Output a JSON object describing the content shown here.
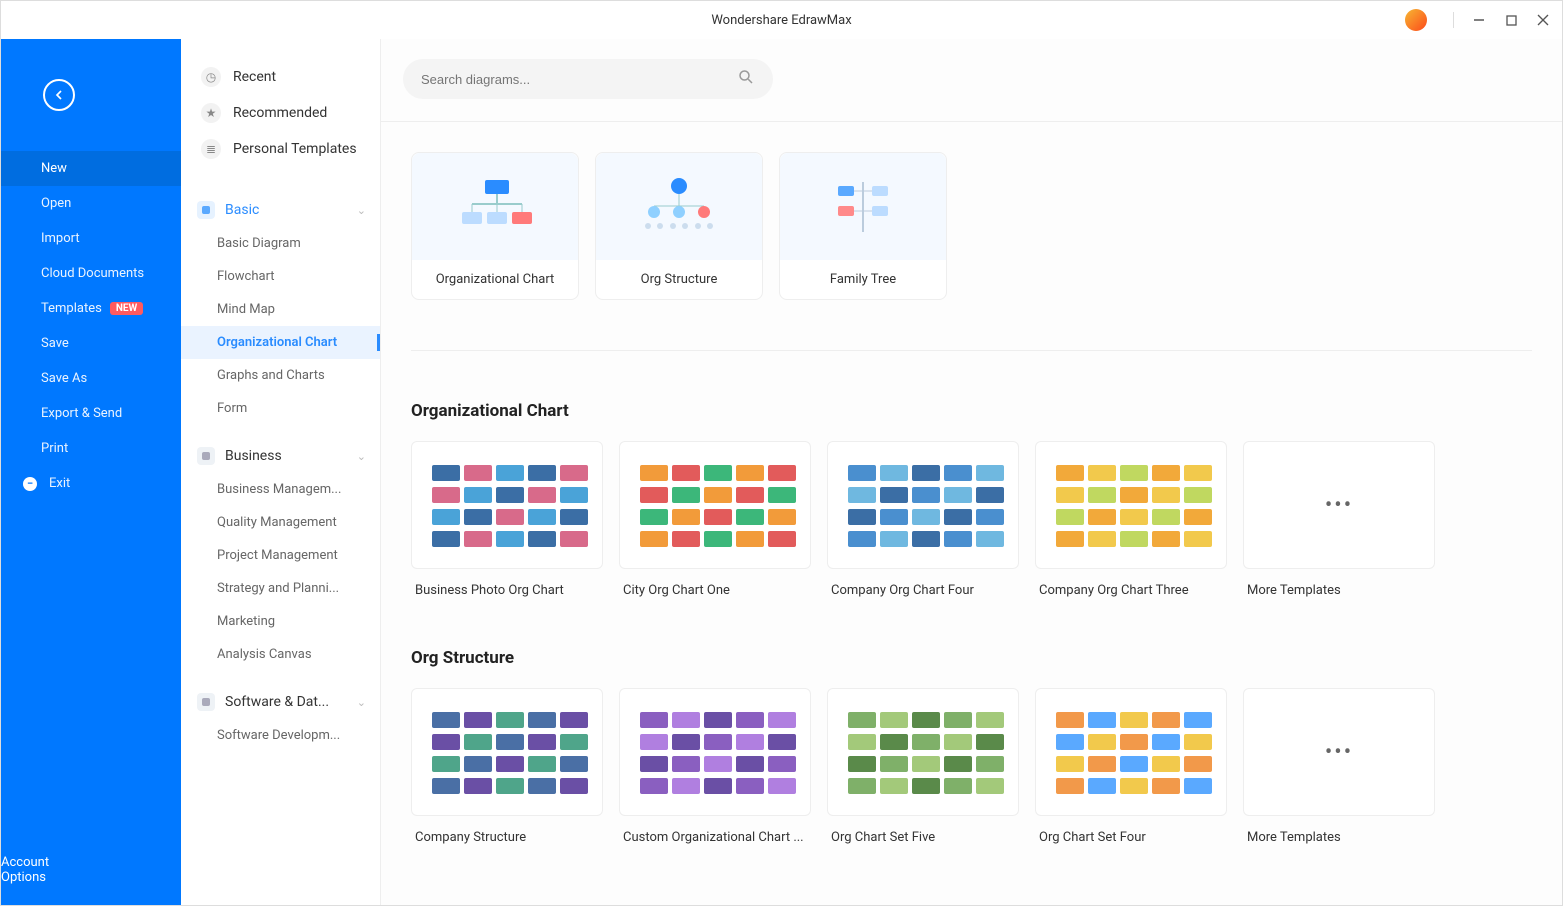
{
  "app_title": "Wondershare EdrawMax",
  "search": {
    "placeholder": "Search diagrams..."
  },
  "sidebar": {
    "items": [
      {
        "label": "New",
        "active": true
      },
      {
        "label": "Open"
      },
      {
        "label": "Import"
      },
      {
        "label": "Cloud Documents"
      },
      {
        "label": "Templates",
        "badge": "NEW"
      },
      {
        "label": "Save"
      },
      {
        "label": "Save As"
      },
      {
        "label": "Export & Send"
      },
      {
        "label": "Print"
      },
      {
        "label": "Exit",
        "exit": true
      }
    ],
    "bottom": [
      {
        "label": "Account"
      },
      {
        "label": "Options"
      }
    ]
  },
  "categories": {
    "top": [
      {
        "label": "Recent"
      },
      {
        "label": "Recommended"
      },
      {
        "label": "Personal Templates"
      }
    ],
    "groups": [
      {
        "label": "Basic",
        "active": true,
        "children": [
          {
            "label": "Basic Diagram"
          },
          {
            "label": "Flowchart"
          },
          {
            "label": "Mind Map"
          },
          {
            "label": "Organizational Chart",
            "active": true
          },
          {
            "label": "Graphs and Charts"
          },
          {
            "label": "Form"
          }
        ]
      },
      {
        "label": "Business",
        "children": [
          {
            "label": "Business Managem..."
          },
          {
            "label": "Quality Management"
          },
          {
            "label": "Project Management"
          },
          {
            "label": "Strategy and Planni..."
          },
          {
            "label": "Marketing"
          },
          {
            "label": "Analysis Canvas"
          }
        ]
      },
      {
        "label": "Software & Dat...",
        "children": [
          {
            "label": "Software Developm..."
          }
        ]
      }
    ]
  },
  "type_cards": [
    {
      "label": "Organizational Chart"
    },
    {
      "label": "Org Structure"
    },
    {
      "label": "Family Tree"
    }
  ],
  "sections": [
    {
      "title": "Organizational Chart",
      "templates": [
        {
          "label": "Business Photo Org Chart"
        },
        {
          "label": "City Org Chart One"
        },
        {
          "label": "Company Org Chart Four"
        },
        {
          "label": "Company Org Chart Three"
        },
        {
          "label": "More Templates",
          "more": true
        }
      ]
    },
    {
      "title": "Org Structure",
      "templates": [
        {
          "label": "Company Structure"
        },
        {
          "label": "Custom Organizational Chart ..."
        },
        {
          "label": "Org Chart Set Five"
        },
        {
          "label": "Org Chart Set Four"
        },
        {
          "label": "More Templates",
          "more": true
        }
      ]
    }
  ]
}
